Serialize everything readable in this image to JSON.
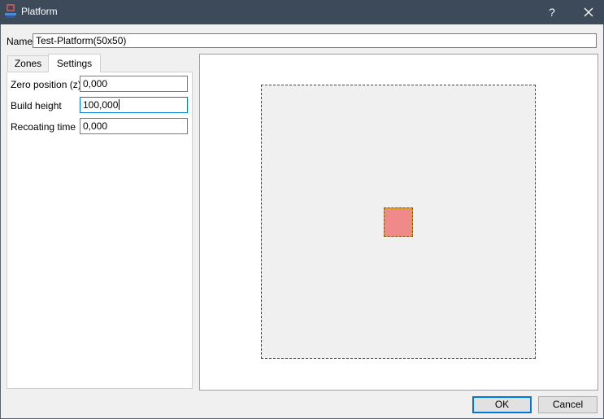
{
  "window": {
    "title": "Platform",
    "icon": "platform-app-icon",
    "help_label": "?",
    "close_icon": "close-icon"
  },
  "name_row": {
    "label": "Name",
    "value": "Test-Platform(50x50)"
  },
  "tabs": [
    {
      "label": "Zones",
      "active": false
    },
    {
      "label": "Settings",
      "active": true
    }
  ],
  "settings": {
    "zero_position": {
      "label": "Zero position (z)",
      "value": "0,000"
    },
    "build_height": {
      "label": "Build height",
      "value": "100,000"
    },
    "recoating_time": {
      "label": "Recoating time",
      "value": "0,000"
    }
  },
  "preview": {
    "platform_fill": "#f0f0f0",
    "zone_fill": "#f08a8a",
    "zone_border": "#e0a030"
  },
  "buttons": {
    "ok": "OK",
    "cancel": "Cancel"
  },
  "colors": {
    "titlebar": "#3c4a59",
    "focus_accent": "#0078d7"
  }
}
